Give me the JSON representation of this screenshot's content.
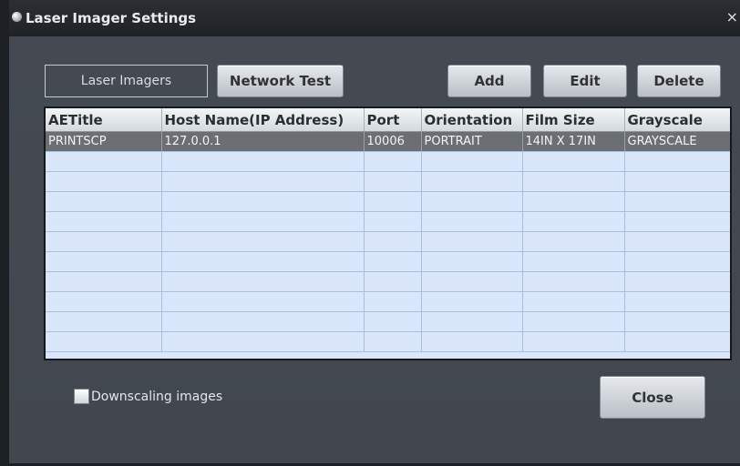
{
  "window": {
    "title": "Laser Imager Settings",
    "close_glyph": "×"
  },
  "toolbar": {
    "laser_imagers_label": "Laser Imagers",
    "network_test_label": "Network Test",
    "add_label": "Add",
    "edit_label": "Edit",
    "delete_label": "Delete"
  },
  "table": {
    "columns": [
      "AETitle",
      "Host Name(IP Address)",
      "Port",
      "Orientation",
      "Film Size",
      "Grayscale"
    ],
    "rows": [
      [
        "PRINTSCP",
        "127.0.0.1",
        "10006",
        "PORTRAIT",
        "14IN X 17IN",
        "GRAYSCALE"
      ],
      [
        "",
        "",
        "",
        "",
        "",
        ""
      ],
      [
        "",
        "",
        "",
        "",
        "",
        ""
      ],
      [
        "",
        "",
        "",
        "",
        "",
        ""
      ],
      [
        "",
        "",
        "",
        "",
        "",
        ""
      ],
      [
        "",
        "",
        "",
        "",
        "",
        ""
      ],
      [
        "",
        "",
        "",
        "",
        "",
        ""
      ],
      [
        "",
        "",
        "",
        "",
        "",
        ""
      ],
      [
        "",
        "",
        "",
        "",
        "",
        ""
      ],
      [
        "",
        "",
        "",
        "",
        "",
        ""
      ],
      [
        "",
        "",
        "",
        "",
        "",
        ""
      ]
    ]
  },
  "options": {
    "downscaling_label": "Downscaling images",
    "downscaling_checked": false
  },
  "footer": {
    "close_label": "Close"
  }
}
